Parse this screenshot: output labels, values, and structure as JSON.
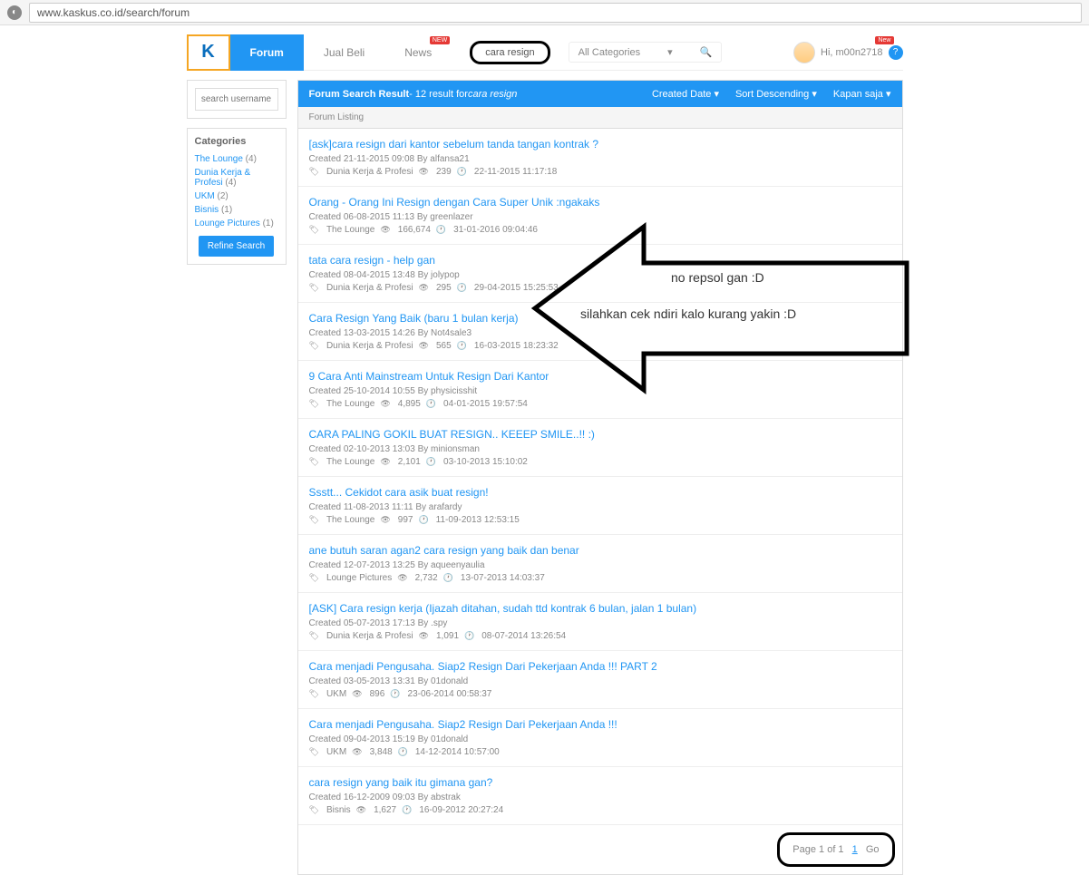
{
  "browser": {
    "url": "www.kaskus.co.id/search/forum"
  },
  "header": {
    "logo": "K",
    "nav": {
      "forum": "Forum",
      "jualbeli": "Jual Beli",
      "news": "News",
      "newBadge": "NEW"
    },
    "search": "cara resign",
    "category": "All Categories",
    "user": "Hi, m00n2718",
    "userBadge": "New"
  },
  "sidebar": {
    "searchPlaceholder": "search username",
    "catTitle": "Categories",
    "cats": [
      {
        "name": "The Lounge",
        "count": "(4)"
      },
      {
        "name": "Dunia Kerja & Profesi",
        "count": "(4)"
      },
      {
        "name": "UKM",
        "count": "(2)"
      },
      {
        "name": "Bisnis",
        "count": "(1)"
      },
      {
        "name": "Lounge Pictures",
        "count": "(1)"
      }
    ],
    "refine": "Refine Search"
  },
  "results": {
    "headerBold": "Forum Search Result",
    "headerRest": " - 12 result for ",
    "headerTerm": "cara resign",
    "filters": {
      "created": "Created Date",
      "sort": "Sort Descending",
      "kapan": "Kapan saja"
    },
    "listing": "Forum Listing",
    "threads": [
      {
        "title": "[ask]cara resign dari kantor sebelum tanda tangan kontrak ?",
        "meta": "Created 21-11-2015 09:08 By alfansa21",
        "cat": "Dunia Kerja & Profesi",
        "views": "239",
        "time": "22-11-2015 11:17:18"
      },
      {
        "title": "Orang - Orang Ini Resign dengan Cara Super Unik :ngakaks",
        "meta": "Created 06-08-2015 11:13 By greenlazer",
        "cat": "The Lounge",
        "views": "166,674",
        "time": "31-01-2016 09:04:46"
      },
      {
        "title": "tata cara resign - help gan",
        "meta": "Created 08-04-2015 13:48 By jolypop",
        "cat": "Dunia Kerja & Profesi",
        "views": "295",
        "time": "29-04-2015 15:25:53"
      },
      {
        "title": "Cara Resign Yang Baik (baru 1 bulan kerja)",
        "meta": "Created 13-03-2015 14:26 By Not4sale3",
        "cat": "Dunia Kerja & Profesi",
        "views": "565",
        "time": "16-03-2015 18:23:32"
      },
      {
        "title": "9 Cara Anti Mainstream Untuk Resign Dari Kantor",
        "meta": "Created 25-10-2014 10:55 By physicisshit",
        "cat": "The Lounge",
        "views": "4,895",
        "time": "04-01-2015 19:57:54"
      },
      {
        "title": "CARA PALING GOKIL BUAT RESIGN.. KEEEP SMILE..!! :)",
        "meta": "Created 02-10-2013 13:03 By minionsman",
        "cat": "The Lounge",
        "views": "2,101",
        "time": "03-10-2013 15:10:02"
      },
      {
        "title": "Ssstt... Cekidot cara asik buat resign!",
        "meta": "Created 11-08-2013 11:11 By arafardy",
        "cat": "The Lounge",
        "views": "997",
        "time": "11-09-2013 12:53:15"
      },
      {
        "title": "ane butuh saran agan2 cara resign yang baik dan benar",
        "meta": "Created 12-07-2013 13:25 By aqueenyaulia",
        "cat": "Lounge Pictures",
        "views": "2,732",
        "time": "13-07-2013 14:03:37"
      },
      {
        "title": "[ASK] Cara resign kerja (Ijazah ditahan, sudah ttd kontrak 6 bulan, jalan 1 bulan)",
        "meta": "Created 05-07-2013 17:13 By .spy",
        "cat": "Dunia Kerja & Profesi",
        "views": "1,091",
        "time": "08-07-2014 13:26:54"
      },
      {
        "title": "Cara menjadi Pengusaha. Siap2 Resign Dari Pekerjaan Anda !!! PART 2",
        "meta": "Created 03-05-2013 13:31 By 01donald",
        "cat": "UKM",
        "views": "896",
        "time": "23-06-2014 00:58:37"
      },
      {
        "title": "Cara menjadi Pengusaha. Siap2 Resign Dari Pekerjaan Anda !!!",
        "meta": "Created 09-04-2013 15:19 By 01donald",
        "cat": "UKM",
        "views": "3,848",
        "time": "14-12-2014 10:57:00"
      },
      {
        "title": "cara resign yang baik itu gimana gan?",
        "meta": "Created 16-12-2009 09:03 By abstrak",
        "cat": "Bisnis",
        "views": "1,627",
        "time": "16-09-2012 20:27:24"
      }
    ],
    "pagination": {
      "label": "Page 1 of 1",
      "cur": "1",
      "go": "Go"
    }
  },
  "annot": {
    "line1": "no repsol gan :D",
    "line2": "silahkan cek ndiri kalo kurang yakin :D"
  }
}
